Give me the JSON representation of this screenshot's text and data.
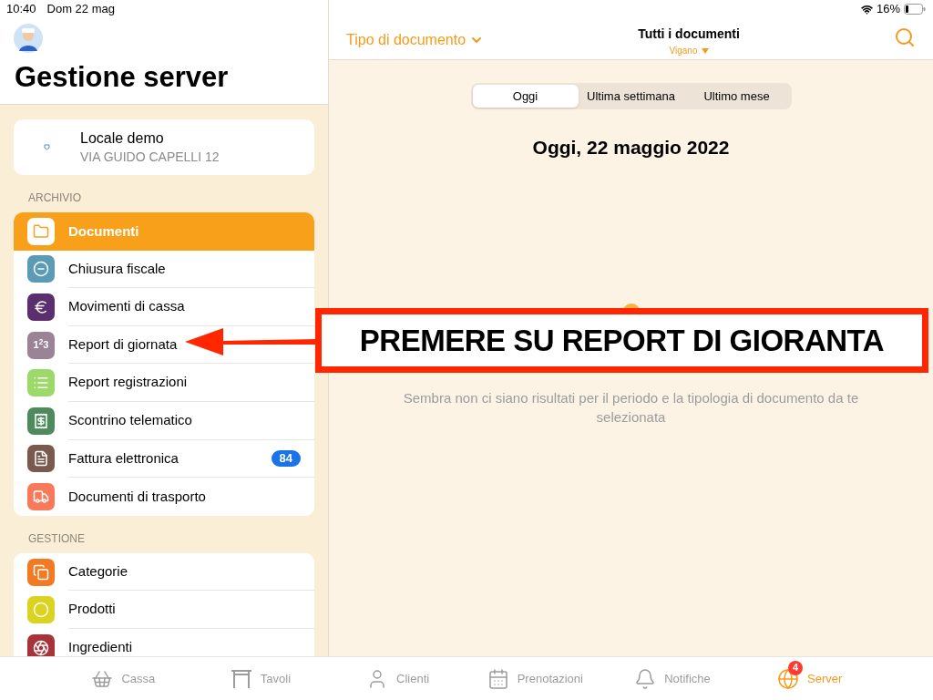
{
  "status_bar": {
    "time": "10:40",
    "date": "Dom 22 mag",
    "battery": "16%"
  },
  "sidebar": {
    "title": "Gestione server",
    "venue": {
      "name": "Locale demo",
      "address": "VIA GUIDO CAPELLI 12"
    },
    "sections": [
      {
        "heading": "ARCHIVIO",
        "items": [
          {
            "label": "Documenti",
            "kind": "folder",
            "color": "#ffffff",
            "selected": true
          },
          {
            "label": "Chiusura fiscale",
            "kind": "circle-minus",
            "color": "#5b9bb5",
            "selected": false
          },
          {
            "label": "Movimenti di cassa",
            "kind": "euro",
            "color": "#5b2e6e",
            "selected": false
          },
          {
            "label": "Report di giornata",
            "kind": "numbers",
            "icon_text": "1$^{2}$3",
            "color": "#9a8297",
            "selected": false
          },
          {
            "label": "Report registrazioni",
            "kind": "list",
            "color": "#9dd86b",
            "selected": false
          },
          {
            "label": "Scontrino telematico",
            "kind": "receipt",
            "color": "#4f8a5c",
            "selected": false
          },
          {
            "label": "Fattura elettronica",
            "kind": "document",
            "color": "#7a5a4e",
            "selected": false,
            "badge": "84"
          },
          {
            "label": "Documenti di trasporto",
            "kind": "truck",
            "color": "#f87a5a",
            "selected": false
          }
        ]
      },
      {
        "heading": "GESTIONE",
        "items": [
          {
            "label": "Categorie",
            "kind": "copy",
            "color": "#f27a22",
            "selected": false
          },
          {
            "label": "Prodotti",
            "kind": "circle",
            "color": "#dcd320",
            "selected": false
          },
          {
            "label": "Ingredienti",
            "kind": "circles",
            "color": "#a8323a",
            "selected": false
          }
        ]
      }
    ]
  },
  "header": {
    "filter": "Tipo di documento",
    "title": "Tutti i documenti",
    "subtitle": "Vigano"
  },
  "segments": [
    {
      "label": "Oggi",
      "selected": true
    },
    {
      "label": "Ultima settimana",
      "selected": false
    },
    {
      "label": "Ultimo mese",
      "selected": false
    }
  ],
  "date_heading": "Oggi, 22 maggio 2022",
  "empty_message": "Sembra non ci siano risultati per il periodo e la tipologia di documento da te selezionata",
  "annotation": {
    "text": "PREMERE SU REPORT DI GIORANTA"
  },
  "tab_bar": [
    {
      "label": "Cassa",
      "kind": "basket",
      "selected": false
    },
    {
      "label": "Tavoli",
      "kind": "table",
      "selected": false
    },
    {
      "label": "Clienti",
      "kind": "user",
      "selected": false
    },
    {
      "label": "Prenotazioni",
      "kind": "calendar",
      "selected": false
    },
    {
      "label": "Notifiche",
      "kind": "bell",
      "selected": false
    },
    {
      "label": "Server",
      "kind": "globe",
      "selected": true,
      "badge": "4"
    }
  ]
}
